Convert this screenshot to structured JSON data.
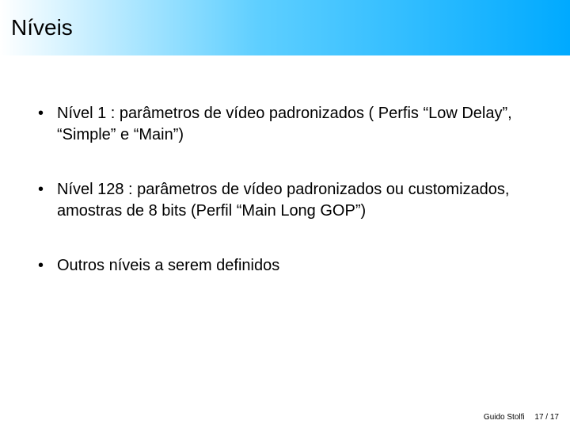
{
  "title": "Níveis",
  "bullets": [
    "Nível 1 : parâmetros de vídeo padronizados ( Perfis “Low Delay”, “Simple” e “Main”)",
    "Nível 128 : parâmetros de vídeo padronizados ou customizados, amostras de 8 bits (Perfil “Main Long GOP”)",
    "Outros níveis a serem definidos"
  ],
  "footer": {
    "author": "Guido Stolfi",
    "page": "17 / 17"
  }
}
